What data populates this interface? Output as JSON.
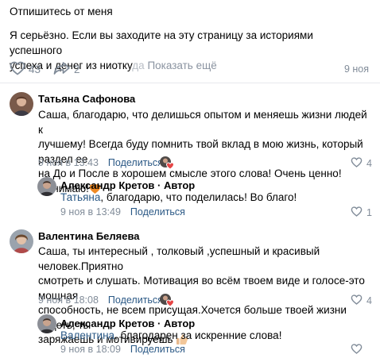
{
  "post": {
    "title": "Отпишитесь от меня",
    "text_line1": "Я серьёзно. Если вы заходите на эту страницу за историями успешного",
    "text_line2_visible": "успеха и денег из ниотку",
    "text_line2_faded": "да",
    "show_more": "Показать ещё",
    "likes": "43",
    "shares": "2",
    "date": "9 ноя"
  },
  "comments": [
    {
      "author": "Татьяна Сафонова",
      "text_lines": [
        "Саша, благодарю, что делишься опытом и меняешь жизни людей к",
        "лучшему! Всегда буду помнить твой вклад в мою жизнь, который раздел ее",
        "на До и После в хорошем смысле этого слова! Очень ценно!",
        "Обнимаю!"
      ],
      "date": "9 ноя в 13:43",
      "reply_label": "Поделиться",
      "likes": "4",
      "reply": {
        "author": "Александр Кретов",
        "role": " · Автор",
        "mention": "Татьяна",
        "text": ", благодарю, что поделилась! Во благо!",
        "date": "9 ноя в 13:49",
        "reply_label": "Поделиться",
        "likes": "1"
      }
    },
    {
      "author": "Валентина Беляева",
      "text_lines": [
        "Саша, ты интересный , толковый ,успешный и красивый человек.Приятно",
        "смотреть и слушать. Мотивация во всём твоем виде и голосе-это мощная",
        "способность, не всем присущая.Хочется больше твоей жизни видеть, ты",
        "заряжаешь и мотивируешь"
      ],
      "date": "9 ноя в 18:08",
      "reply_label": "Поделиться",
      "likes": "4",
      "reply": {
        "author": "Александр Кретов",
        "role": " · Автор",
        "mention": "Валентина",
        "text": ", благодарен за искренние слова!",
        "date": "9 ноя в 18:09",
        "reply_label": "Поделиться",
        "likes": ""
      }
    }
  ],
  "icons": {
    "like": "heart-outline-icon",
    "share": "share-arrow-icon",
    "reaction_heart": "red-heart-emoji",
    "reaction_thumbs": "thumbs-up-emoji"
  },
  "colors": {
    "link": "#2a5885",
    "muted": "#818c99",
    "heart": "#e64646"
  }
}
